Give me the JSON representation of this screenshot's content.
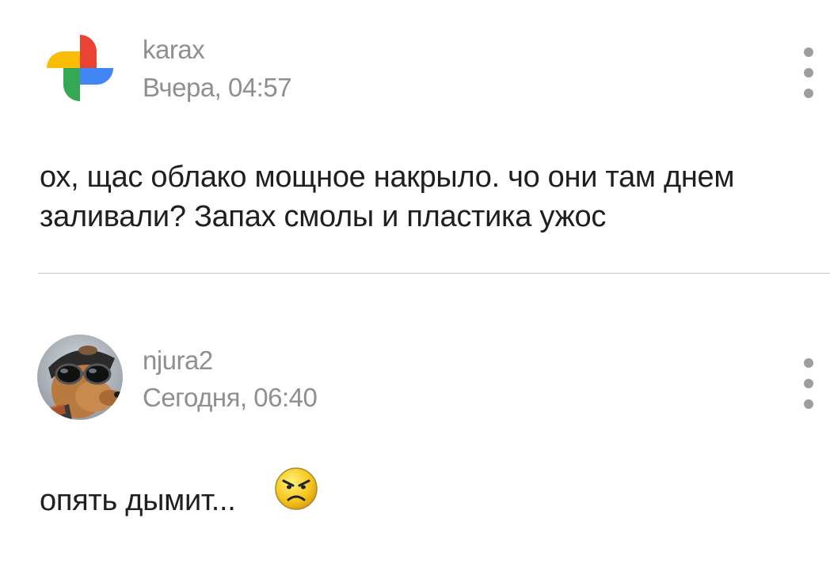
{
  "comments": [
    {
      "author": "karax",
      "time": "Вчера, 04:57",
      "avatar": "google-photos-pinwheel-icon",
      "text": "ох, щас облако мощное накрыло. чо они там днем заливали? Запах смолы и пластика ужос"
    },
    {
      "author": "njura2",
      "time": "Сегодня, 06:40",
      "avatar": "dog-with-goggles-photo",
      "text": "опять дымит...",
      "emoji": "angry-face-emoji"
    }
  ],
  "colors": {
    "meta_text": "#8e8e93",
    "body_text": "#1f1f1f",
    "divider": "#c8c8c8",
    "menu_dots": "#9e9e9e",
    "google_red": "#ea4335",
    "google_yellow": "#fbbc04",
    "google_green": "#34a853",
    "google_blue": "#4285f4"
  }
}
